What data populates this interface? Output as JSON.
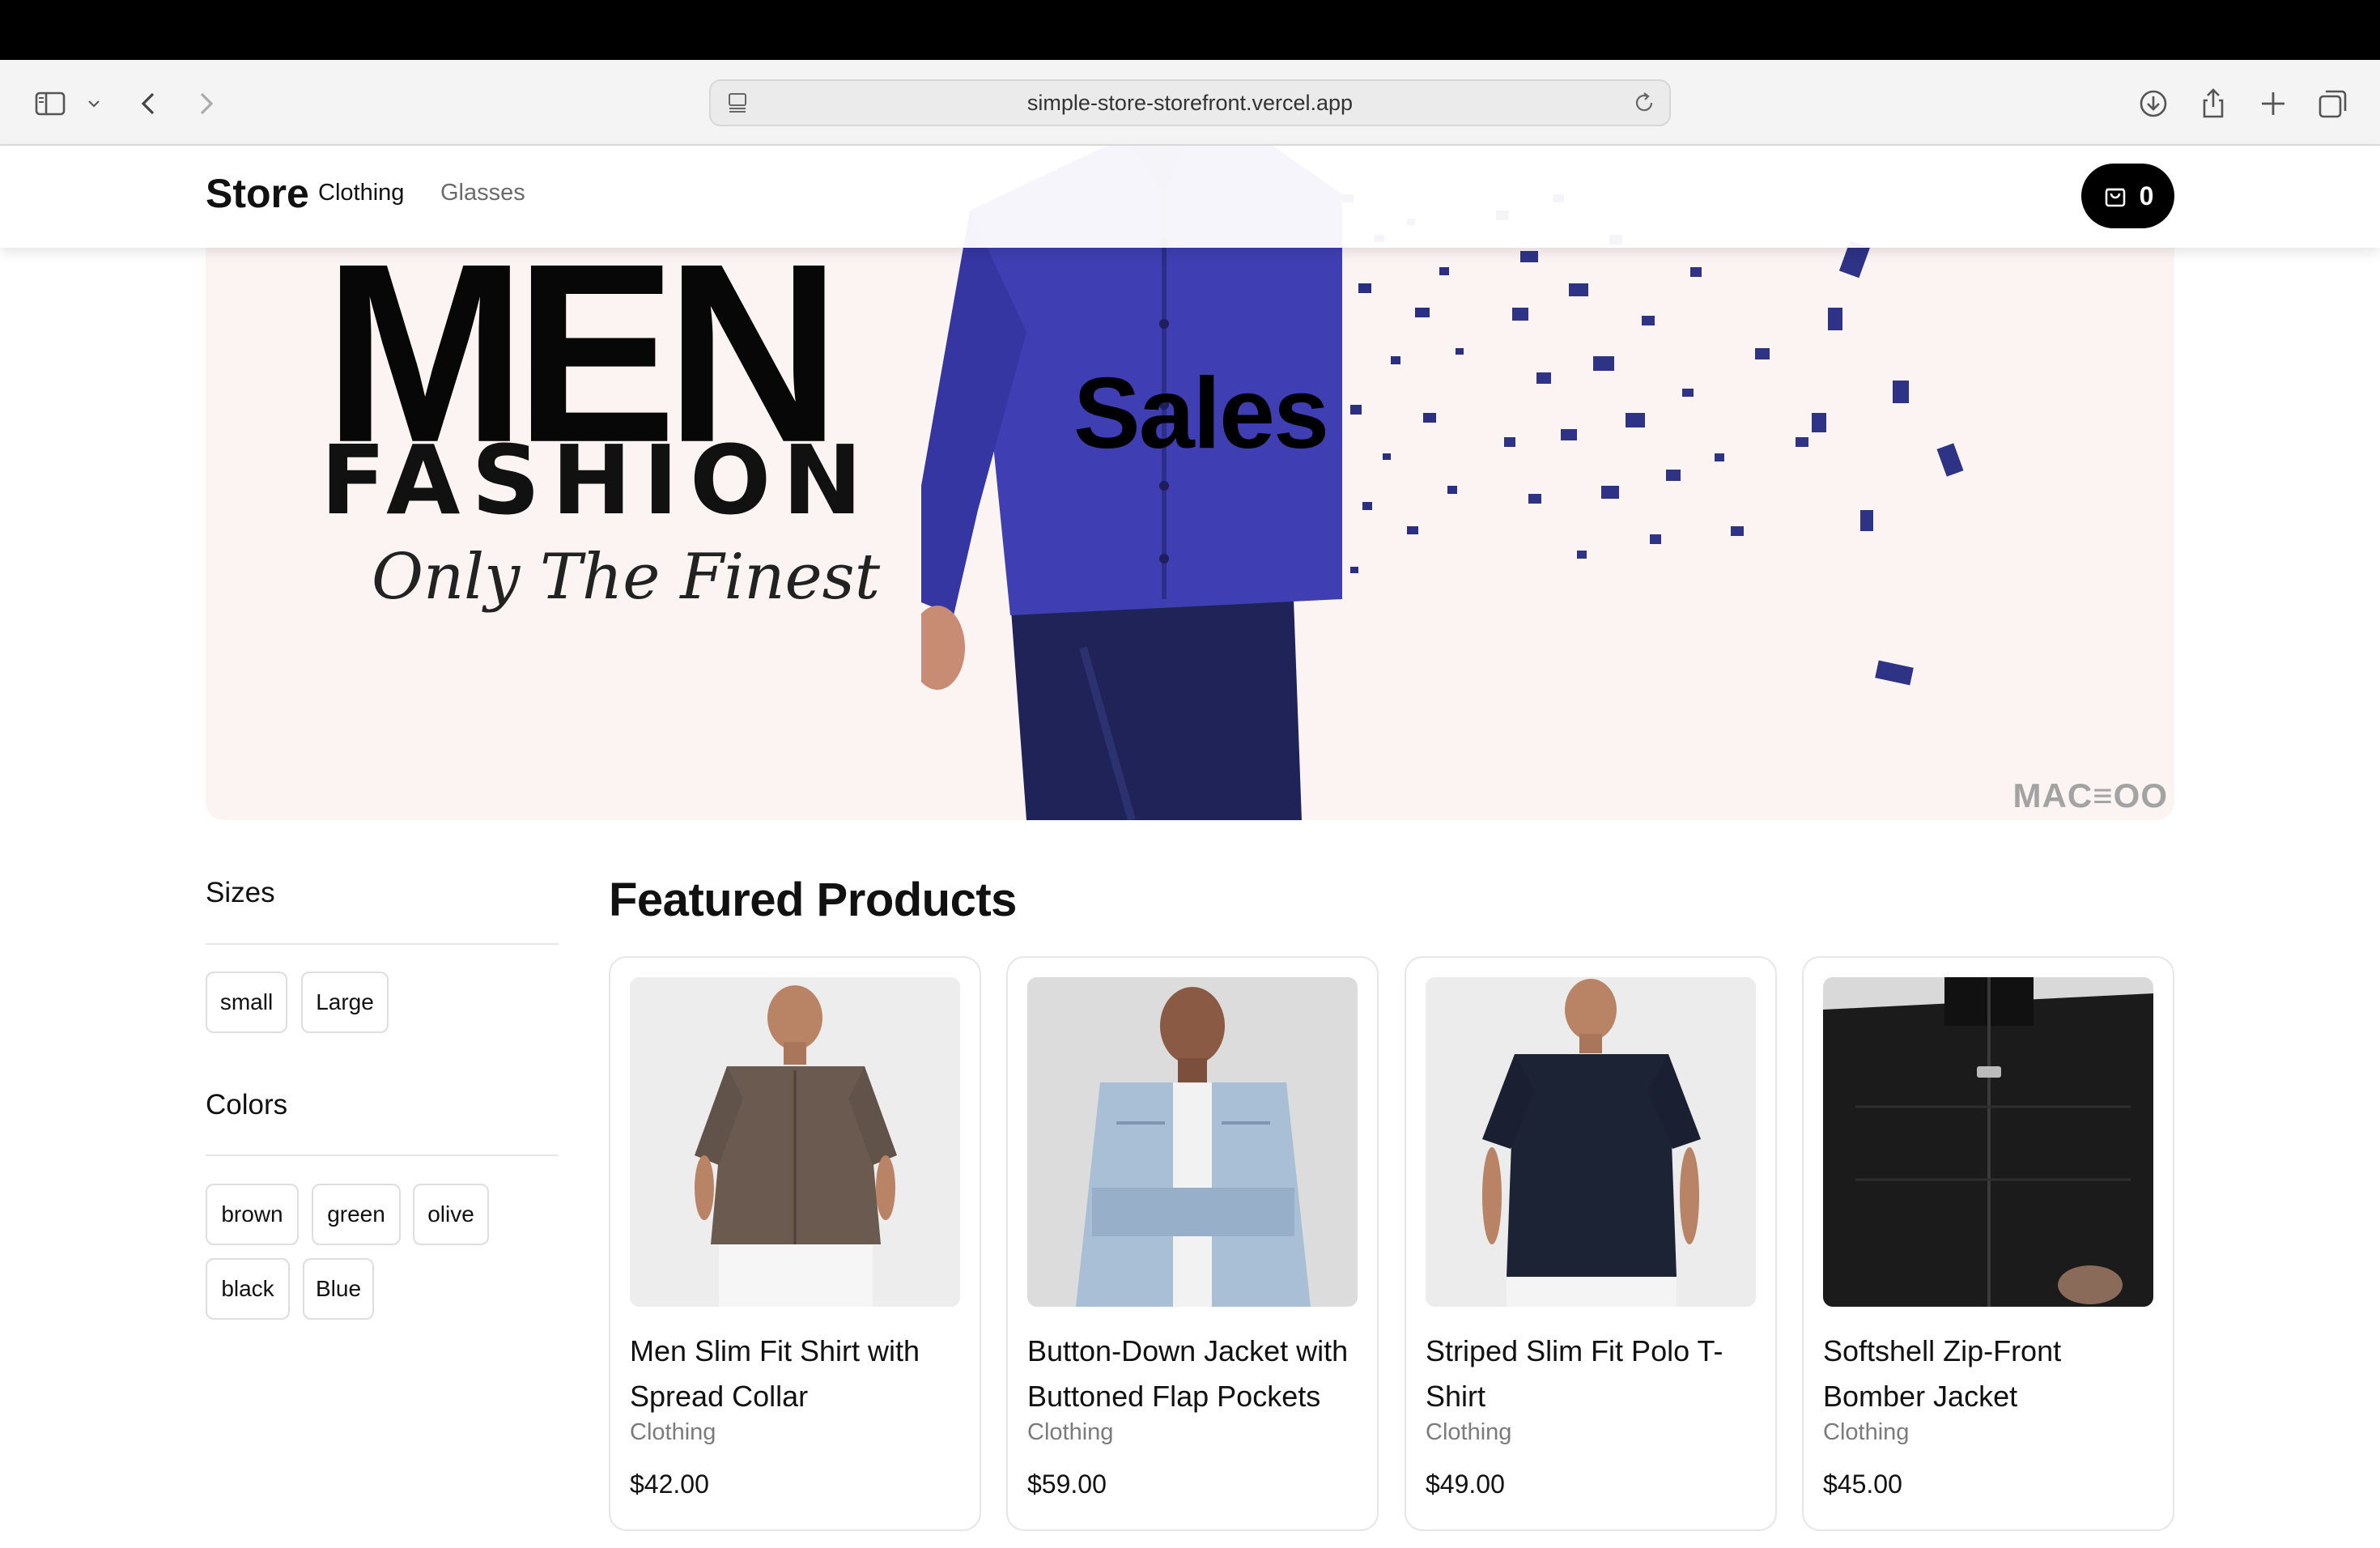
{
  "browser": {
    "url": "simple-store-storefront.vercel.app"
  },
  "store": {
    "brand": "Store",
    "nav": [
      "Clothing",
      "Glasses"
    ],
    "cart_count": "0"
  },
  "hero": {
    "headline": "MEN",
    "subheadline": "FASHION",
    "tagline": "Only The Finest",
    "title": "Sales",
    "watermark": "MAC≡OO"
  },
  "filters": {
    "sizes_heading": "Sizes",
    "sizes": [
      "small",
      "Large"
    ],
    "colors_heading": "Colors",
    "colors": [
      "brown",
      "green",
      "olive",
      "black",
      "Blue"
    ]
  },
  "featured": {
    "heading": "Featured Products",
    "products": [
      {
        "name": "Men Slim Fit Shirt with Spread Collar",
        "category": "Clothing",
        "price": "$42.00",
        "image": "brown-shirt-photo"
      },
      {
        "name": "Button-Down Jacket with Buttoned Flap Pockets",
        "category": "Clothing",
        "price": "$59.00",
        "image": "denim-jacket-photo"
      },
      {
        "name": "Striped Slim Fit Polo T-Shirt",
        "category": "Clothing",
        "price": "$49.00",
        "image": "navy-polo-photo"
      },
      {
        "name": "Softshell Zip-Front Bomber Jacket",
        "category": "Clothing",
        "price": "$45.00",
        "image": "black-bomber-photo"
      }
    ]
  },
  "colors": {
    "cart_bg": "#000000",
    "hero_bg": "#fbf4f3",
    "shirt_blue": "#3f3fb3"
  }
}
